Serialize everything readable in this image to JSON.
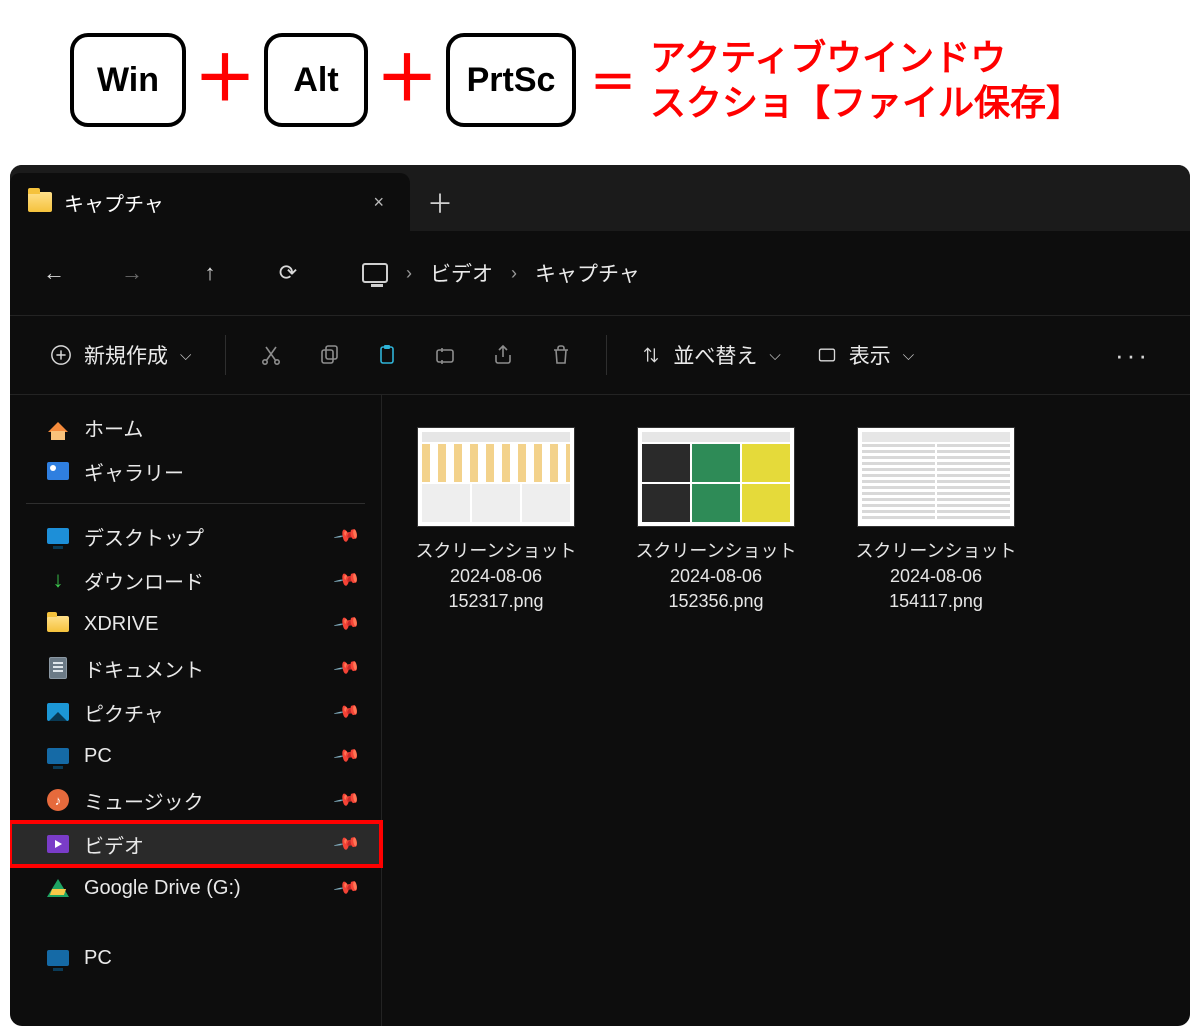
{
  "shortcut": {
    "key1": "Win",
    "key2": "Alt",
    "key3": "PrtSc",
    "plus": "＋",
    "eq": "＝",
    "line1": "アクティブウインドウ",
    "line2": "スクショ【ファイル保存】"
  },
  "tab": {
    "title": "キャプチャ",
    "close": "×",
    "plus": "＋"
  },
  "nav": {
    "back": "←",
    "forward": "→",
    "up": "↑",
    "refresh": "⟳"
  },
  "breadcrumb": {
    "sep": "›",
    "item1": "ビデオ",
    "item2": "キャプチャ"
  },
  "toolbar": {
    "new": "新規作成",
    "sort": "並べ替え",
    "view": "表示",
    "chev": "⌵",
    "more": "···"
  },
  "sidebar": {
    "home": "ホーム",
    "gallery": "ギャラリー",
    "desktop": "デスクトップ",
    "downloads": "ダウンロード",
    "xdrive": "XDRIVE",
    "documents": "ドキュメント",
    "pictures": "ピクチャ",
    "pc": "PC",
    "music": "ミュージック",
    "video": "ビデオ",
    "gdrive": "Google Drive (G:)",
    "pc2": "PC",
    "pin": "📌",
    "dl": "↓",
    "note": "♪"
  },
  "files": {
    "f1": {
      "l1": "スクリーンショット",
      "l2": "2024-08-06",
      "l3": "152317.png"
    },
    "f2": {
      "l1": "スクリーンショット",
      "l2": "2024-08-06",
      "l3": "152356.png"
    },
    "f3": {
      "l1": "スクリーンショット",
      "l2": "2024-08-06",
      "l3": "154117.png"
    }
  }
}
